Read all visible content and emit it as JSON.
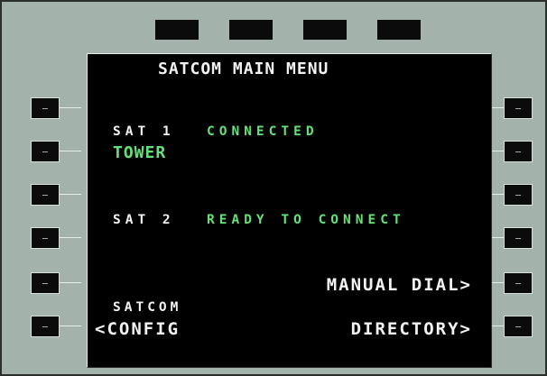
{
  "screen": {
    "title": "SATCOM MAIN MENU",
    "sat1_label": "SAT 1",
    "sat1_status": "CONNECTED",
    "sat1_name": "TOWER",
    "sat2_label": "SAT 2",
    "sat2_status": "READY TO CONNECT",
    "manual_dial": "MANUAL DIAL>",
    "satcom_small": "SATCOM",
    "config": "<CONFIG",
    "directory": "DIRECTORY>"
  },
  "keys": {
    "left": [
      "-",
      "-",
      "-",
      "-",
      "-",
      "-"
    ],
    "right": [
      "-",
      "-",
      "-",
      "-",
      "-",
      "-"
    ]
  },
  "colors": {
    "bezel": "#a3b3ab",
    "screen": "#000000",
    "text_white": "#f2f2f2",
    "text_green": "#66e07a"
  }
}
